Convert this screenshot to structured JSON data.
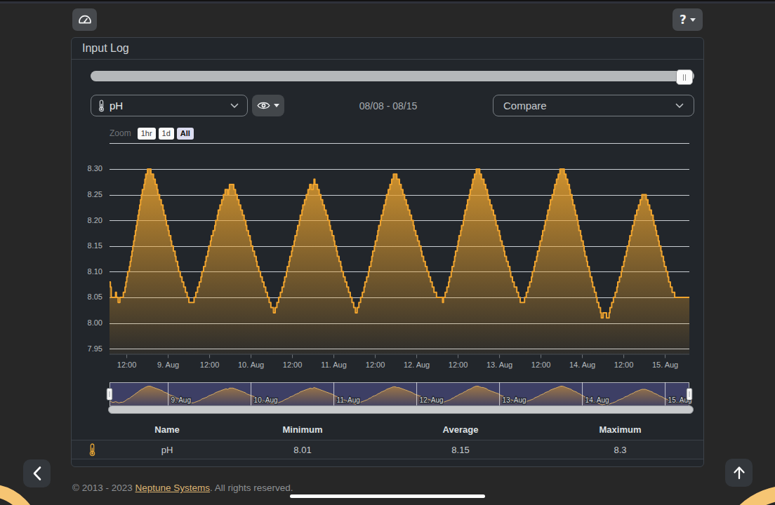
{
  "toolbar": {
    "dashboard_button": {
      "icon": "gauge-icon"
    },
    "help_button": {
      "icon": "question-icon",
      "caret": "caret-down"
    }
  },
  "panel": {
    "title": "Input Log"
  },
  "controls": {
    "probe_select": {
      "icon": "thermometer-icon",
      "value": "pH"
    },
    "visibility_button": {
      "icon": "eye-icon"
    },
    "date_range": "08/08 - 08/15",
    "compare_select": {
      "value": "Compare"
    }
  },
  "chart_data": {
    "type": "area",
    "series_name": "pH",
    "line_color": "#f0a42e",
    "fill_color": "#e9a22f",
    "grid_color": "#c9ced3",
    "label_color": "#b4b9bd",
    "ylim": [
      7.94,
      8.35
    ],
    "y_ticks": [
      {
        "v": 7.95,
        "label": "7.95"
      },
      {
        "v": 8.0,
        "label": "8.00"
      },
      {
        "v": 8.05,
        "label": "8.05"
      },
      {
        "v": 8.1,
        "label": "8.10"
      },
      {
        "v": 8.15,
        "label": "8.15"
      },
      {
        "v": 8.2,
        "label": "8.20"
      },
      {
        "v": 8.25,
        "label": "8.25"
      },
      {
        "v": 8.3,
        "label": "8.30"
      },
      {
        "v": 8.35,
        "label": ""
      }
    ],
    "x_ticks": [
      {
        "t": 12,
        "label": "12:00"
      },
      {
        "t": 24,
        "label": "9. Aug"
      },
      {
        "t": 36,
        "label": "12:00"
      },
      {
        "t": 48,
        "label": "10. Aug"
      },
      {
        "t": 60,
        "label": "12:00"
      },
      {
        "t": 72,
        "label": "11. Aug"
      },
      {
        "t": 84,
        "label": "12:00"
      },
      {
        "t": 96,
        "label": "12. Aug"
      },
      {
        "t": 108,
        "label": "12:00"
      },
      {
        "t": 120,
        "label": "13. Aug"
      },
      {
        "t": 132,
        "label": "12:00"
      },
      {
        "t": 144,
        "label": "14. Aug"
      },
      {
        "t": 156,
        "label": "12:00"
      },
      {
        "t": 168,
        "label": "15. Aug"
      }
    ],
    "x_start_hour": 7.0,
    "x_end_hour": 175.0,
    "sample_step_hours": 0.25,
    "values": [
      8.08,
      8.07,
      8.05,
      8.05,
      8.05,
      8.05,
      8.05,
      8.06,
      8.05,
      8.05,
      8.04,
      8.04,
      8.05,
      8.05,
      8.05,
      8.05,
      8.06,
      8.06,
      8.07,
      8.08,
      8.09,
      8.1,
      8.1,
      8.11,
      8.12,
      8.13,
      8.14,
      8.15,
      8.16,
      8.17,
      8.18,
      8.19,
      8.2,
      8.21,
      8.22,
      8.23,
      8.24,
      8.25,
      8.26,
      8.26,
      8.27,
      8.28,
      8.29,
      8.29,
      8.3,
      8.3,
      8.3,
      8.3,
      8.29,
      8.29,
      8.29,
      8.28,
      8.28,
      8.27,
      8.27,
      8.26,
      8.25,
      8.25,
      8.24,
      8.24,
      8.23,
      8.23,
      8.22,
      8.21,
      8.21,
      8.2,
      8.19,
      8.19,
      8.18,
      8.17,
      8.17,
      8.16,
      8.15,
      8.15,
      8.14,
      8.14,
      8.13,
      8.12,
      8.12,
      8.11,
      8.1,
      8.1,
      8.09,
      8.09,
      8.08,
      8.08,
      8.07,
      8.07,
      8.06,
      8.06,
      8.05,
      8.05,
      8.04,
      8.04,
      8.04,
      8.04,
      8.04,
      8.04,
      8.05,
      8.05,
      8.06,
      8.06,
      8.07,
      8.07,
      8.08,
      8.08,
      8.09,
      8.1,
      8.1,
      8.11,
      8.11,
      8.12,
      8.13,
      8.13,
      8.14,
      8.15,
      8.15,
      8.16,
      8.17,
      8.17,
      8.18,
      8.18,
      8.19,
      8.2,
      8.2,
      8.21,
      8.22,
      8.22,
      8.23,
      8.23,
      8.24,
      8.24,
      8.25,
      8.25,
      8.26,
      8.26,
      8.26,
      8.25,
      8.26,
      8.27,
      8.27,
      8.27,
      8.27,
      8.27,
      8.26,
      8.26,
      8.25,
      8.25,
      8.24,
      8.24,
      8.23,
      8.23,
      8.22,
      8.22,
      8.21,
      8.21,
      8.2,
      8.2,
      8.19,
      8.18,
      8.18,
      8.17,
      8.17,
      8.16,
      8.15,
      8.15,
      8.14,
      8.14,
      8.13,
      8.13,
      8.12,
      8.11,
      8.11,
      8.1,
      8.1,
      8.09,
      8.09,
      8.08,
      8.08,
      8.07,
      8.07,
      8.06,
      8.06,
      8.05,
      8.05,
      8.04,
      8.04,
      8.03,
      8.03,
      8.03,
      8.02,
      8.02,
      8.03,
      8.03,
      8.04,
      8.04,
      8.05,
      8.05,
      8.06,
      8.06,
      8.07,
      8.07,
      8.08,
      8.09,
      8.09,
      8.1,
      8.11,
      8.11,
      8.12,
      8.13,
      8.13,
      8.14,
      8.15,
      8.15,
      8.16,
      8.17,
      8.17,
      8.18,
      8.19,
      8.19,
      8.2,
      8.21,
      8.21,
      8.22,
      8.23,
      8.23,
      8.24,
      8.24,
      8.25,
      8.25,
      8.26,
      8.26,
      8.27,
      8.27,
      8.26,
      8.26,
      8.27,
      8.28,
      8.27,
      8.27,
      8.27,
      8.26,
      8.26,
      8.25,
      8.25,
      8.24,
      8.24,
      8.23,
      8.23,
      8.22,
      8.22,
      8.21,
      8.21,
      8.2,
      8.2,
      8.19,
      8.18,
      8.18,
      8.17,
      8.17,
      8.16,
      8.15,
      8.15,
      8.14,
      8.13,
      8.13,
      8.12,
      8.12,
      8.11,
      8.1,
      8.1,
      8.09,
      8.09,
      8.08,
      8.08,
      8.07,
      8.07,
      8.06,
      8.06,
      8.05,
      8.05,
      8.04,
      8.04,
      8.03,
      8.03,
      8.02,
      8.02,
      8.03,
      8.03,
      8.04,
      8.04,
      8.05,
      8.05,
      8.06,
      8.06,
      8.07,
      8.08,
      8.08,
      8.09,
      8.09,
      8.1,
      8.11,
      8.11,
      8.12,
      8.13,
      8.14,
      8.14,
      8.15,
      8.16,
      8.16,
      8.17,
      8.18,
      8.19,
      8.19,
      8.2,
      8.21,
      8.21,
      8.22,
      8.23,
      8.23,
      8.24,
      8.25,
      8.25,
      8.26,
      8.26,
      8.27,
      8.27,
      8.28,
      8.28,
      8.29,
      8.29,
      8.29,
      8.29,
      8.28,
      8.28,
      8.28,
      8.27,
      8.27,
      8.26,
      8.26,
      8.25,
      8.25,
      8.24,
      8.24,
      8.23,
      8.23,
      8.22,
      8.22,
      8.21,
      8.21,
      8.2,
      8.2,
      8.19,
      8.18,
      8.18,
      8.17,
      8.17,
      8.16,
      8.16,
      8.15,
      8.15,
      8.14,
      8.13,
      8.13,
      8.12,
      8.12,
      8.11,
      8.11,
      8.1,
      8.1,
      8.09,
      8.09,
      8.08,
      8.08,
      8.07,
      8.07,
      8.06,
      8.06,
      8.06,
      8.05,
      8.05,
      8.05,
      8.05,
      8.05,
      8.05,
      8.05,
      8.04,
      8.05,
      8.05,
      8.06,
      8.06,
      8.07,
      8.07,
      8.08,
      8.09,
      8.09,
      8.1,
      8.11,
      8.11,
      8.12,
      8.13,
      8.14,
      8.14,
      8.15,
      8.16,
      8.17,
      8.17,
      8.18,
      8.19,
      8.19,
      8.2,
      8.21,
      8.22,
      8.22,
      8.23,
      8.24,
      8.24,
      8.25,
      8.26,
      8.26,
      8.27,
      8.28,
      8.28,
      8.29,
      8.29,
      8.3,
      8.3,
      8.3,
      8.3,
      8.29,
      8.29,
      8.28,
      8.28,
      8.28,
      8.27,
      8.27,
      8.26,
      8.26,
      8.25,
      8.24,
      8.24,
      8.23,
      8.23,
      8.22,
      8.22,
      8.21,
      8.21,
      8.2,
      8.19,
      8.19,
      8.18,
      8.18,
      8.17,
      8.16,
      8.16,
      8.15,
      8.15,
      8.14,
      8.13,
      8.13,
      8.12,
      8.12,
      8.11,
      8.11,
      8.1,
      8.09,
      8.09,
      8.08,
      8.08,
      8.07,
      8.07,
      8.07,
      8.06,
      8.06,
      8.05,
      8.05,
      8.04,
      8.04,
      8.04,
      8.04,
      8.04,
      8.05,
      8.05,
      8.06,
      8.06,
      8.07,
      8.07,
      8.08,
      8.08,
      8.09,
      8.1,
      8.1,
      8.11,
      8.12,
      8.12,
      8.13,
      8.14,
      8.14,
      8.15,
      8.16,
      8.16,
      8.17,
      8.18,
      8.18,
      8.19,
      8.2,
      8.2,
      8.21,
      8.22,
      8.22,
      8.23,
      8.24,
      8.24,
      8.25,
      8.25,
      8.26,
      8.27,
      8.27,
      8.28,
      8.28,
      8.29,
      8.29,
      8.3,
      8.3,
      8.3,
      8.3,
      8.3,
      8.29,
      8.29,
      8.28,
      8.28,
      8.27,
      8.27,
      8.26,
      8.25,
      8.25,
      8.24,
      8.23,
      8.23,
      8.22,
      8.21,
      8.21,
      8.2,
      8.19,
      8.18,
      8.18,
      8.17,
      8.16,
      8.16,
      8.15,
      8.14,
      8.13,
      8.13,
      8.12,
      8.11,
      8.11,
      8.1,
      8.09,
      8.09,
      8.08,
      8.07,
      8.07,
      8.06,
      8.06,
      8.05,
      8.04,
      8.04,
      8.03,
      8.03,
      8.02,
      8.01,
      8.01,
      8.02,
      8.02,
      8.02,
      8.02,
      8.01,
      8.01,
      8.01,
      8.02,
      8.03,
      8.03,
      8.04,
      8.04,
      8.05,
      8.05,
      8.06,
      8.06,
      8.07,
      8.08,
      8.08,
      8.09,
      8.09,
      8.1,
      8.11,
      8.11,
      8.12,
      8.13,
      8.13,
      8.14,
      8.15,
      8.15,
      8.16,
      8.17,
      8.17,
      8.18,
      8.19,
      8.19,
      8.2,
      8.21,
      8.21,
      8.22,
      8.22,
      8.23,
      8.23,
      8.24,
      8.24,
      8.25,
      8.25,
      8.25,
      8.25,
      8.25,
      8.24,
      8.24,
      8.23,
      8.23,
      8.22,
      8.22,
      8.21,
      8.21,
      8.2,
      8.19,
      8.19,
      8.18,
      8.17,
      8.17,
      8.16,
      8.15,
      8.15,
      8.14,
      8.13,
      8.13,
      8.12,
      8.11,
      8.11,
      8.1,
      8.1,
      8.09,
      8.08,
      8.08,
      8.07,
      8.07,
      8.06,
      8.06,
      8.06,
      8.05,
      8.05,
      8.05,
      8.05,
      8.05,
      8.05,
      8.05,
      8.05,
      8.05,
      8.05,
      8.05,
      8.05,
      8.05,
      8.05,
      8.05,
      8.05,
      8.05,
      8.05
    ],
    "zoom": {
      "label": "Zoom",
      "buttons": [
        "1hr",
        "1d",
        "All"
      ],
      "selected": "All"
    },
    "navigator": {
      "mask_color": "rgba(104,104,196,0.38)",
      "outline_color": "#bcbfc2",
      "day_marks": [
        {
          "t": 24,
          "label": "9. Aug"
        },
        {
          "t": 48,
          "label": "10. Aug"
        },
        {
          "t": 72,
          "label": "11. Aug"
        },
        {
          "t": 96,
          "label": "12. Aug"
        },
        {
          "t": 120,
          "label": "13. Aug"
        },
        {
          "t": 144,
          "label": "14. Aug"
        },
        {
          "t": 168,
          "label": "15. Aug"
        }
      ]
    }
  },
  "summary_table": {
    "headers": [
      "Name",
      "Minimum",
      "Average",
      "Maximum"
    ],
    "row": {
      "icon": "thermometer-icon",
      "name": "pH",
      "minimum": "8.01",
      "average": "8.15",
      "maximum": "8.3"
    }
  },
  "footer": {
    "copyright_prefix": "© 2013 - 2023 ",
    "link_text": "Neptune Systems",
    "suffix": ". All rights reserved."
  },
  "nav_buttons": {
    "back": "chevron-left-icon",
    "scroll_top": "arrow-up-icon"
  }
}
